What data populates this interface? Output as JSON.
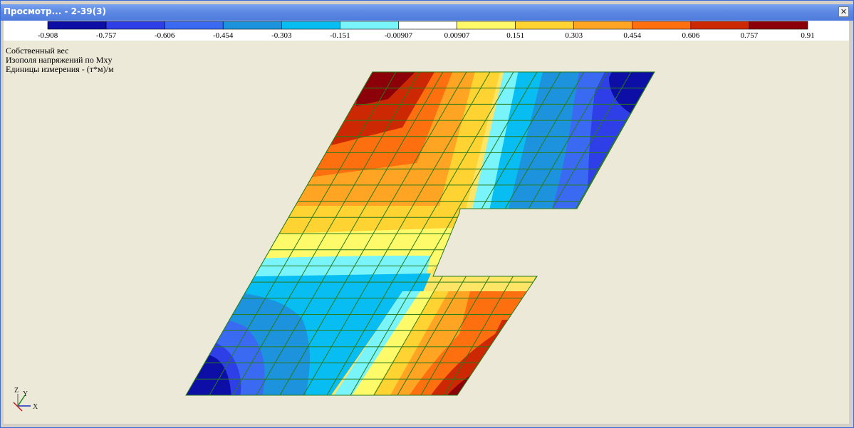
{
  "window": {
    "title": "Просмотр... - 2-39(3)",
    "close_glyph": "✕"
  },
  "legend": {
    "colors": [
      "#0c0ea6",
      "#2e3fe8",
      "#3a6af2",
      "#1c93dc",
      "#08bdf2",
      "#79f4fa",
      "#ffffff",
      "#fffa6a",
      "#ffd331",
      "#ffa523",
      "#fe6f10",
      "#cd2804",
      "#8b0009"
    ],
    "ticks": [
      "-0.908",
      "-0.757",
      "-0.606",
      "-0.454",
      "-0.303",
      "-0.151",
      "-0.00907",
      "0.00907",
      "0.151",
      "0.303",
      "0.454",
      "0.606",
      "0.757",
      "0.91"
    ]
  },
  "labels": {
    "case": "Собственный вес",
    "isofield": "Изополя напряжений по Mxy",
    "units": "Единицы измерения - (т*м)/м"
  },
  "axes": {
    "z": "Z",
    "y": "Y",
    "x": "X"
  }
}
